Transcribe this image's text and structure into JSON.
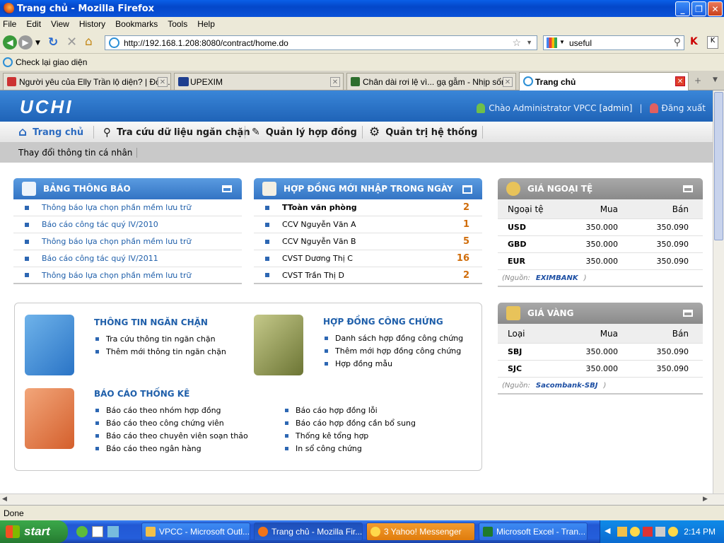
{
  "window": {
    "title": "Trang chủ - Mozilla Firefox"
  },
  "menu": [
    "File",
    "Edit",
    "View",
    "History",
    "Bookmarks",
    "Tools",
    "Help"
  ],
  "nav": {
    "url": "http://192.168.1.208:8080/contract/home.do",
    "search_value": "useful"
  },
  "bookmarks": {
    "item": "Check lại giao diện"
  },
  "tabs": [
    {
      "label": "Người yêu của Elly Trần lộ diện? | Đời ..."
    },
    {
      "label": "UPEXIM"
    },
    {
      "label": "Chân dài rơi lệ vì... gạ gẫm - Nhịp sốn..."
    },
    {
      "label": "Trang chủ"
    }
  ],
  "app": {
    "logo": "UCHI",
    "welcome": "Chào Administrator VPCC",
    "user": "[admin]",
    "logout": "Đăng xuất",
    "nav": [
      "Trang chủ",
      "Tra cứu dữ liệu ngăn chặn",
      "Quản lý hợp đồng",
      "Quản trị hệ thống"
    ],
    "subnav": "Thay đổi thông tin cá nhân"
  },
  "notices": {
    "title": "BẢNG THÔNG BÁO",
    "items": [
      "Thông báo lựa chọn phần mềm lưu trữ",
      "Báo cáo công tác quý IV/2010",
      "Thông báo lựa chọn phần mềm lưu trữ",
      "Báo cáo công tác quý IV/2011",
      "Thông báo lựa chọn phần mềm lưu trữ"
    ]
  },
  "contracts_today": {
    "title": "HỢP ĐỒNG MỚI NHẬP TRONG NGÀY",
    "rows": [
      {
        "name": "TToàn văn phòng",
        "count": "2"
      },
      {
        "name": "CCV Nguyễn Văn A",
        "count": "1"
      },
      {
        "name": "CCV Nguyễn Văn B",
        "count": "5"
      },
      {
        "name": "CVST Dương Thị C",
        "count": "16"
      },
      {
        "name": "CVST Trần Thị D",
        "count": "2"
      }
    ]
  },
  "forex": {
    "title": "GIÁ NGOẠI TỆ",
    "headers": [
      "Ngoại tệ",
      "Mua",
      "Bán"
    ],
    "rows": [
      {
        "code": "USD",
        "buy": "350.000",
        "sell": "350.090"
      },
      {
        "code": "GBD",
        "buy": "350.000",
        "sell": "350.090"
      },
      {
        "code": "EUR",
        "buy": "350.000",
        "sell": "350.090"
      }
    ],
    "source_label": "(Nguồn:",
    "source_name": "EXIMBANK",
    "source_close": ")"
  },
  "gold": {
    "title": "GIÁ VÀNG",
    "headers": [
      "Loại",
      "Mua",
      "Bán"
    ],
    "rows": [
      {
        "code": "SBJ",
        "buy": "350.000",
        "sell": "350.090"
      },
      {
        "code": "SJC",
        "buy": "350.000",
        "sell": "350.090"
      }
    ],
    "source_label": "(Nguồn:",
    "source_name": "Sacombank-SBJ",
    "source_close": ")"
  },
  "sections": {
    "block": {
      "title": "THÔNG TIN NGĂN CHẶN",
      "items": [
        "Tra cứu thông tin ngăn chặn",
        "Thêm mới thông tin ngăn chặn"
      ]
    },
    "notary": {
      "title": "HỢP ĐỒNG CÔNG CHỨNG",
      "items": [
        "Danh sách hợp đồng công chứng",
        "Thêm mới hợp đồng công chứng",
        "Hợp đồng mẫu"
      ]
    },
    "reports": {
      "title": "BÁO CÁO THỐNG KÊ",
      "items_left": [
        "Báo cáo theo nhóm hợp đồng",
        "Báo cáo theo công chứng viên",
        "Báo cáo theo chuyên viên soạn thảo",
        "Báo cáo theo ngân hàng"
      ],
      "items_right": [
        "Báo cáo hợp đồng lỗi",
        "Báo cáo hợp đồng cần bổ sung",
        "Thống kê tổng hợp",
        "In sổ công chứng"
      ]
    }
  },
  "status": "Done",
  "taskbar": {
    "start": "start",
    "tasks": [
      "VPCC - Microsoft Outl...",
      "Trang chủ - Mozilla Fir...",
      "3 Yahoo! Messenger",
      "Microsoft Excel - Tran..."
    ],
    "clock": "2:14 PM"
  },
  "colors": {
    "accent": "#3374c4",
    "count": "#d06d0b",
    "link": "#1f5faa"
  }
}
